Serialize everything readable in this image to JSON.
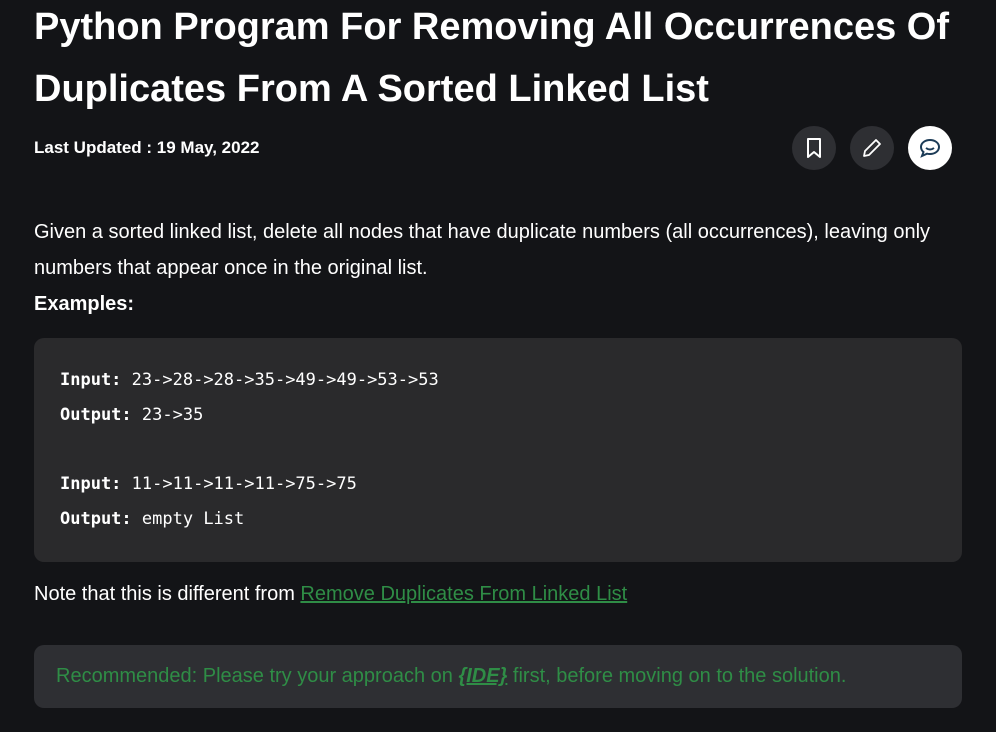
{
  "article": {
    "title": "Python Program For Removing All Occurrences Of Duplicates From A Sorted Linked List",
    "last_updated": "Last Updated : 19 May, 2022",
    "actions": {
      "bookmark": "bookmark-icon",
      "edit": "pencil-icon",
      "discuss": "chat-icon"
    },
    "intro": "Given a sorted linked list, delete all nodes that have duplicate numbers (all occurrences), leaving only numbers that appear once in the original list.",
    "examples_label": "Examples",
    "examples_colon": ":",
    "code": {
      "input_label": "Input:",
      "output_label": "Output:",
      "ex1_input": "23->28->28->35->49->49->53->53",
      "ex1_output": "23->35",
      "ex2_input": "11->11->11->11->75->75",
      "ex2_output": "empty List"
    },
    "note_text": "Note that this is different from ",
    "note_link": "Remove Duplicates From Linked List",
    "recommended_before": "Recommended: Please try your approach on ",
    "recommended_link": "{IDE}",
    "recommended_after": " first, before moving on to the solution.",
    "link_color": "#2f8d46"
  }
}
